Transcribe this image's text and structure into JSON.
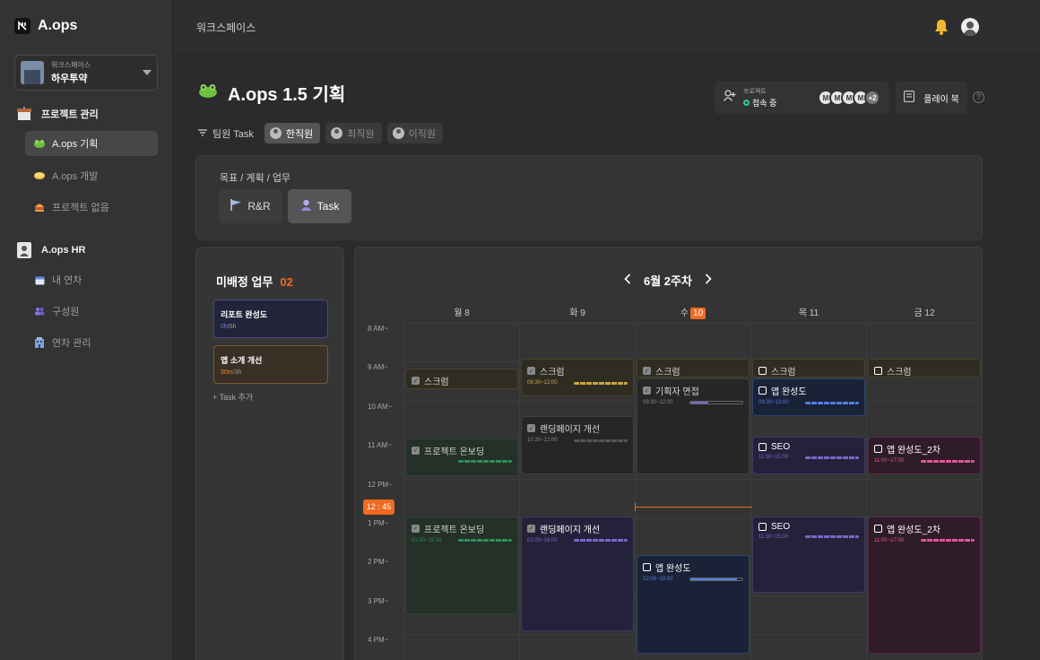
{
  "app": {
    "name": "A.ops"
  },
  "workspace": {
    "label": "워크스페이스",
    "name": "하우투약"
  },
  "sidebar": {
    "section1": {
      "title": "프로젝트 관리"
    },
    "projects": [
      {
        "label": "A.ops 기획",
        "icon": "frog-icon",
        "active": true
      },
      {
        "label": "A.ops 개발",
        "icon": "coin-icon",
        "active": false
      },
      {
        "label": "프로젝트 없음",
        "icon": "hamburger-icon",
        "active": false
      }
    ],
    "section2": {
      "title": "A.ops HR"
    },
    "hr": [
      {
        "label": "내 연차",
        "icon": "calendar-icon"
      },
      {
        "label": "구성원",
        "icon": "people-icon"
      },
      {
        "label": "연차 관리",
        "icon": "building-icon"
      }
    ]
  },
  "topbar": {
    "breadcrumb": "워크스페이스"
  },
  "page": {
    "title": "A.ops 1.5 기획",
    "project_label": "프로젝트",
    "status": "접속 중",
    "members": [
      "M",
      "M",
      "M",
      "M"
    ],
    "members_more": "+2",
    "playbook_label": "플레이 북",
    "help": "?"
  },
  "filters": {
    "label": "팀원 Task",
    "members": [
      {
        "name": "한직원",
        "active": true
      },
      {
        "name": "최직원",
        "active": false
      },
      {
        "name": "이직원",
        "active": false
      }
    ]
  },
  "goal": {
    "breadcrumb": "목표 / 계획 / 업무",
    "rr_label": "R&R",
    "task_label": "Task"
  },
  "unplanned": {
    "title": "미배정 업무",
    "count": "02",
    "cards": [
      {
        "title": "리포트 완성도",
        "used": "0h",
        "total": "/6h"
      },
      {
        "title": "앱 소개 개선",
        "used": "30m",
        "total": "/3h"
      }
    ],
    "add_label": "+ Task 추가"
  },
  "calendar": {
    "week_label": "6월 2주차",
    "days": [
      {
        "label": "월 8",
        "today": false
      },
      {
        "label": "화 9",
        "today": false
      },
      {
        "label": "수",
        "num": "10",
        "today": true
      },
      {
        "label": "목 11",
        "today": false
      },
      {
        "label": "금 12",
        "today": false
      }
    ],
    "times": [
      "8 AM~",
      "9 AM~",
      "10 AM~",
      "11 AM~",
      "12 PM~",
      "1 PM~",
      "2 PM~",
      "3 PM~",
      "4 PM~"
    ],
    "now": "12 : 45",
    "colors": {
      "green": "#2f8f5b",
      "yellow": "#c9a645",
      "purple": "#7768c9",
      "blue": "#4f7ee0",
      "pink": "#e25598",
      "gray": "#777777"
    },
    "events": [
      {
        "title": "스크럼",
        "day": 0,
        "start": 9.18,
        "end": 9.7,
        "theme": "yellow",
        "done": true,
        "time": ""
      },
      {
        "title": "프로젝트 온보딩",
        "day": 0,
        "start": 10.97,
        "end": 11.95,
        "theme": "green",
        "done": true,
        "time": ""
      },
      {
        "title": "프로젝트 온보딩",
        "day": 0,
        "start": 12.97,
        "end": 15.5,
        "theme": "green",
        "done": true,
        "time": "01:00~15:30"
      },
      {
        "title": "스크럼",
        "day": 1,
        "start": 8.93,
        "end": 9.9,
        "theme": "yellow",
        "done": true,
        "time": "09:30~12:00"
      },
      {
        "title": "랜딩페이지 개선",
        "day": 1,
        "start": 10.4,
        "end": 11.9,
        "theme": "gray",
        "done": true,
        "time": "10:30~12:00"
      },
      {
        "title": "랜딩페이지 개선",
        "day": 1,
        "start": 12.97,
        "end": 15.93,
        "theme": "purple",
        "done": true,
        "time": "01:00~16:00"
      },
      {
        "title": "스크럼",
        "day": 2,
        "start": 8.93,
        "end": 9.4,
        "theme": "yellow",
        "done": true,
        "time": ""
      },
      {
        "title": "기획자 면접",
        "day": 2,
        "start": 9.43,
        "end": 11.9,
        "theme": "gray",
        "done": true,
        "time": "09:30~12:00",
        "progress": 0.35,
        "progress_theme": "purple"
      },
      {
        "title": "앱 완성도",
        "day": 2,
        "start": 13.97,
        "end": 16.5,
        "theme": "blue",
        "done": false,
        "time": "02:05~18:00",
        "progress": 0.9,
        "progress_theme": "blue"
      },
      {
        "title": "스크럼",
        "day": 3,
        "start": 8.93,
        "end": 9.4,
        "theme": "yellow",
        "done": false,
        "time": ""
      },
      {
        "title": "앱 완성도",
        "day": 3,
        "start": 9.43,
        "end": 10.4,
        "theme": "blue",
        "done": false,
        "time": "09:30~13:00"
      },
      {
        "title": "SEO",
        "day": 3,
        "start": 10.93,
        "end": 11.9,
        "theme": "purple",
        "done": false,
        "time": "11:00~15:00"
      },
      {
        "title": "SEO",
        "day": 3,
        "start": 12.97,
        "end": 14.93,
        "theme": "purple",
        "done": false,
        "time": "11:00~15:00"
      },
      {
        "title": "스크럼",
        "day": 4,
        "start": 8.93,
        "end": 9.4,
        "theme": "yellow",
        "done": false,
        "time": ""
      },
      {
        "title": "앱 완성도_2차",
        "day": 4,
        "start": 10.93,
        "end": 11.9,
        "theme": "pink",
        "done": false,
        "time": "11:00~17:00"
      },
      {
        "title": "앱 완성도_2차",
        "day": 4,
        "start": 12.97,
        "end": 16.5,
        "theme": "pink",
        "done": false,
        "time": "11:00~17:00"
      }
    ]
  }
}
